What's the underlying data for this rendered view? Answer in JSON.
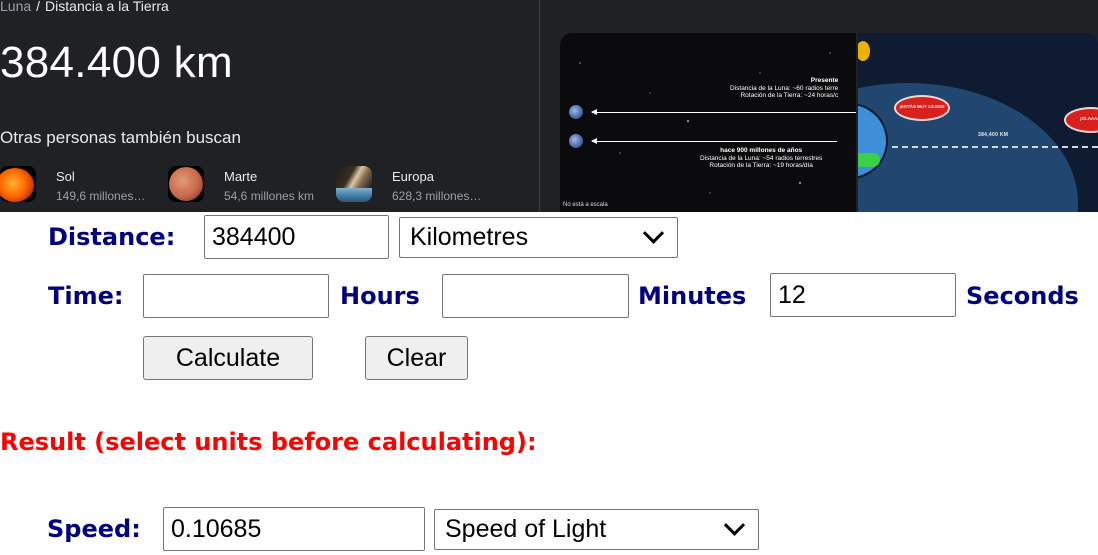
{
  "search_panel": {
    "breadcrumb": {
      "parent": "Luna",
      "separator": "/",
      "current": "Distancia a la Tierra"
    },
    "answer": "384.400 km",
    "also_search_heading": "Otras personas también buscan",
    "related": [
      {
        "name": "Sol",
        "subtitle": "149,6 millones…",
        "thumb": "sun-image"
      },
      {
        "name": "Marte",
        "subtitle": "54,6 millones km",
        "thumb": "mars-image"
      },
      {
        "name": "Europa",
        "subtitle": "628,3 millones…",
        "thumb": "europa-image"
      }
    ],
    "image1": {
      "present_title": "Presente",
      "present_line1": "Distancia de la Luna: ~60 radios terre",
      "present_line2": "Rotación de la Tierra: ~24 horas/c",
      "past_title": "hace 900 millones de años",
      "past_line1": "Distancia de la Luna: ~54 radios terrestres",
      "past_line2": "Rotación de la Tierra: ~19 horas/día",
      "scale_note": "No está a escala"
    },
    "image2": {
      "bubble1": "¡ESTÁS MUY LEJOS!",
      "bubble2": "¡OLAAAA!",
      "distance_label": "384,400 KM"
    }
  },
  "calculator": {
    "distance_label": "Distance:",
    "distance_value": "384400",
    "distance_unit": "Kilometres",
    "time_label": "Time:",
    "hours_value": "",
    "hours_label": "Hours",
    "minutes_value": "",
    "minutes_label": "Minutes",
    "seconds_value": "12",
    "seconds_label": "Seconds",
    "calculate_label": "Calculate",
    "clear_label": "Clear",
    "result_heading": "Result (select units before calculating):",
    "speed_label": "Speed:",
    "speed_value": "0.10685",
    "speed_unit": "Speed of Light"
  },
  "colors": {
    "panel_bg": "#202124",
    "label_navy": "#000080",
    "result_red": "#ff0000"
  }
}
